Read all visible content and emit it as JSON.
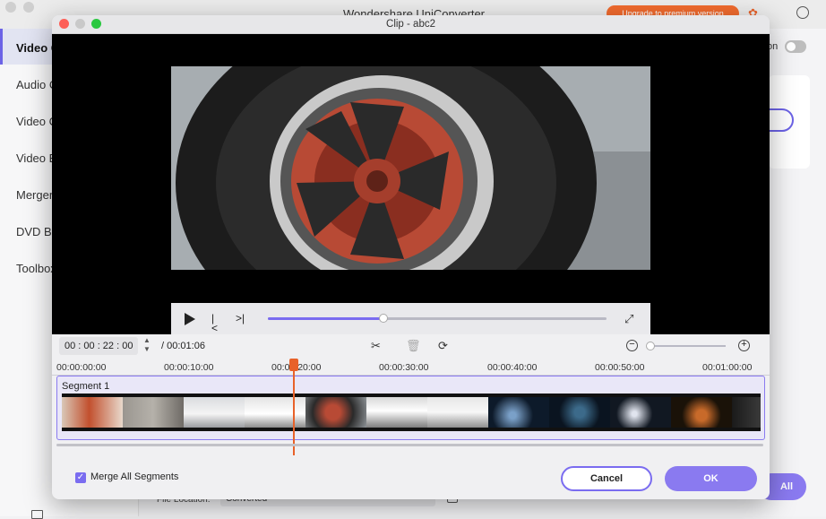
{
  "background_app": {
    "title": "Wondershare UniConverter",
    "upgrade_label": "Upgrade to premium version",
    "sidebar_items": [
      "Video C",
      "Audio C",
      "Video C",
      "Video E",
      "Merger",
      "DVD Bu",
      "Toolbox"
    ],
    "toggle_label": "on",
    "convert_all_label": "All",
    "file_location_label": "File Location:",
    "file_location_value": "Converted"
  },
  "dialog": {
    "title": "Clip - abc2",
    "current_time": "00 : 00 : 22 : 00",
    "total_time": "/ 00:01:06",
    "player_progress_fraction": 0.34,
    "zoom_level_fraction": 0.0,
    "ruler_labels": [
      "00:00:00:00",
      "00:00:10:00",
      "00:00:20:00",
      "00:00:30:00",
      "00:00:40:00",
      "00:00:50:00",
      "00:01:00:00"
    ],
    "segment_label": "Segment 1",
    "merge_label": "Merge All Segments",
    "merge_checked": true,
    "cancel_label": "Cancel",
    "ok_label": "OK"
  },
  "colors": {
    "accent": "#8a7af0",
    "playhead": "#e8622a",
    "upgrade": "#f26b2e"
  },
  "icons": [
    "play-icon",
    "previous-frame-icon",
    "next-frame-icon",
    "fullscreen-icon",
    "scissors-icon",
    "trash-icon",
    "rotate-icon",
    "zoom-out-icon",
    "zoom-in-icon",
    "chevron-up-icon",
    "chevron-down-icon",
    "checkmark-icon",
    "book-icon",
    "chat-icon",
    "gift-icon",
    "folder-icon"
  ]
}
